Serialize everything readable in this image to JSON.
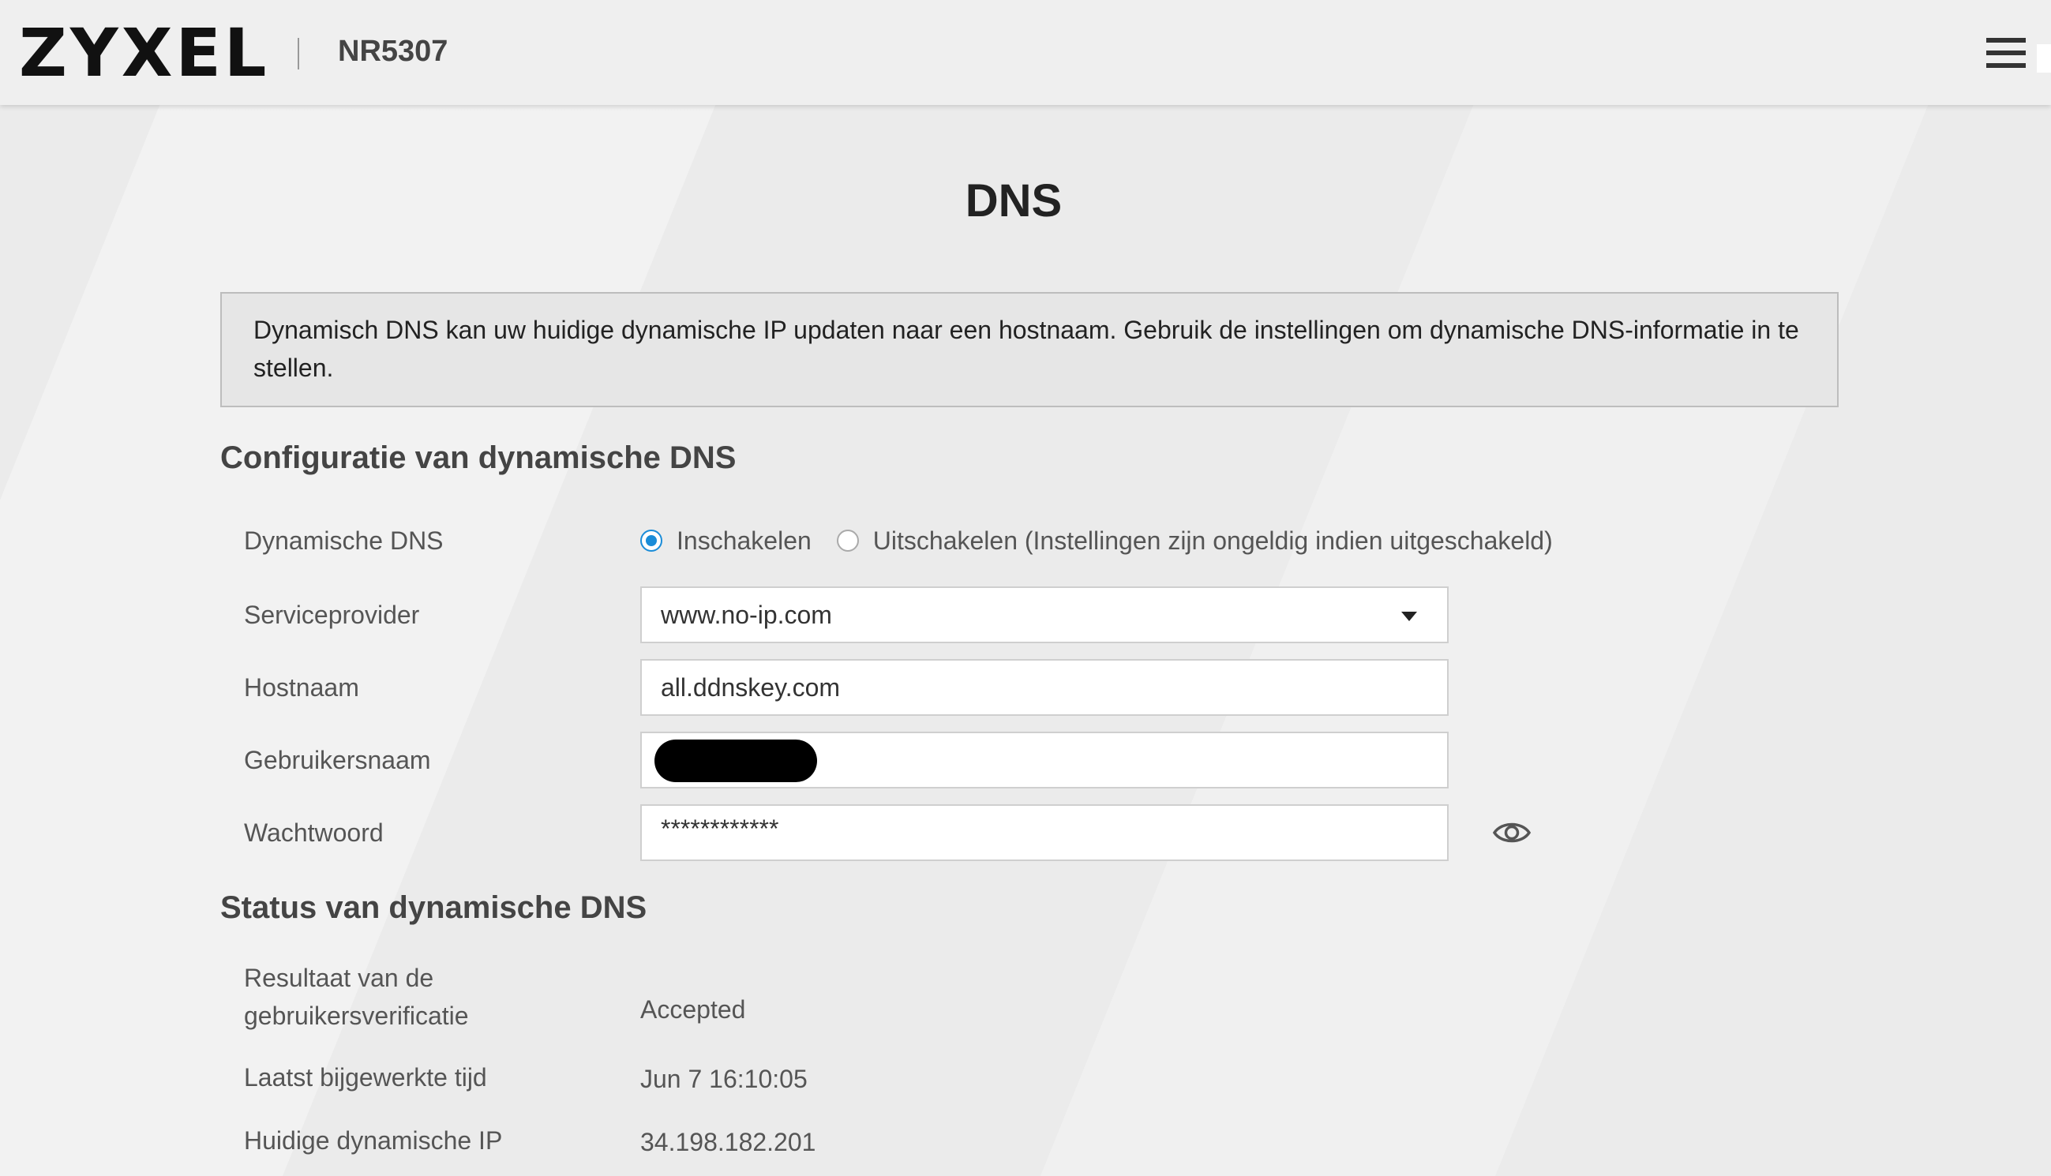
{
  "header": {
    "brand": "ZYXEL",
    "model": "NR5307"
  },
  "page": {
    "title": "DNS",
    "info": "Dynamisch DNS kan uw huidige dynamische IP updaten naar een hostnaam. Gebruik de instellingen om dynamische DNS-informatie in te stellen."
  },
  "config": {
    "section_title": "Configuratie van dynamische DNS",
    "ddns_label": "Dynamische DNS",
    "enable_label": "Inschakelen",
    "disable_label": "Uitschakelen (Instellingen zijn ongeldig indien uitgeschakeld)",
    "enabled": true,
    "provider_label": "Serviceprovider",
    "provider_value": "www.no-ip.com",
    "hostname_label": "Hostnaam",
    "hostname_value": "all.ddnskey.com",
    "username_label": "Gebruikersnaam",
    "password_label": "Wachtwoord",
    "password_value": "************"
  },
  "status": {
    "section_title": "Status van dynamische DNS",
    "auth_result_label_line1": "Resultaat van de",
    "auth_result_label_line2": "gebruikersverificatie",
    "auth_result_value": "Accepted",
    "last_update_label": "Laatst bijgewerkte tijd",
    "last_update_value": "Jun 7 16:10:05",
    "current_ip_label": "Huidige dynamische IP",
    "current_ip_value": "34.198.182.201"
  },
  "colors": {
    "accent": "#1a8cd8",
    "background": "#ececec"
  },
  "icons": {
    "menu": "hamburger-menu-icon",
    "dropdown": "caret-down-icon",
    "password_toggle": "eye-icon"
  }
}
